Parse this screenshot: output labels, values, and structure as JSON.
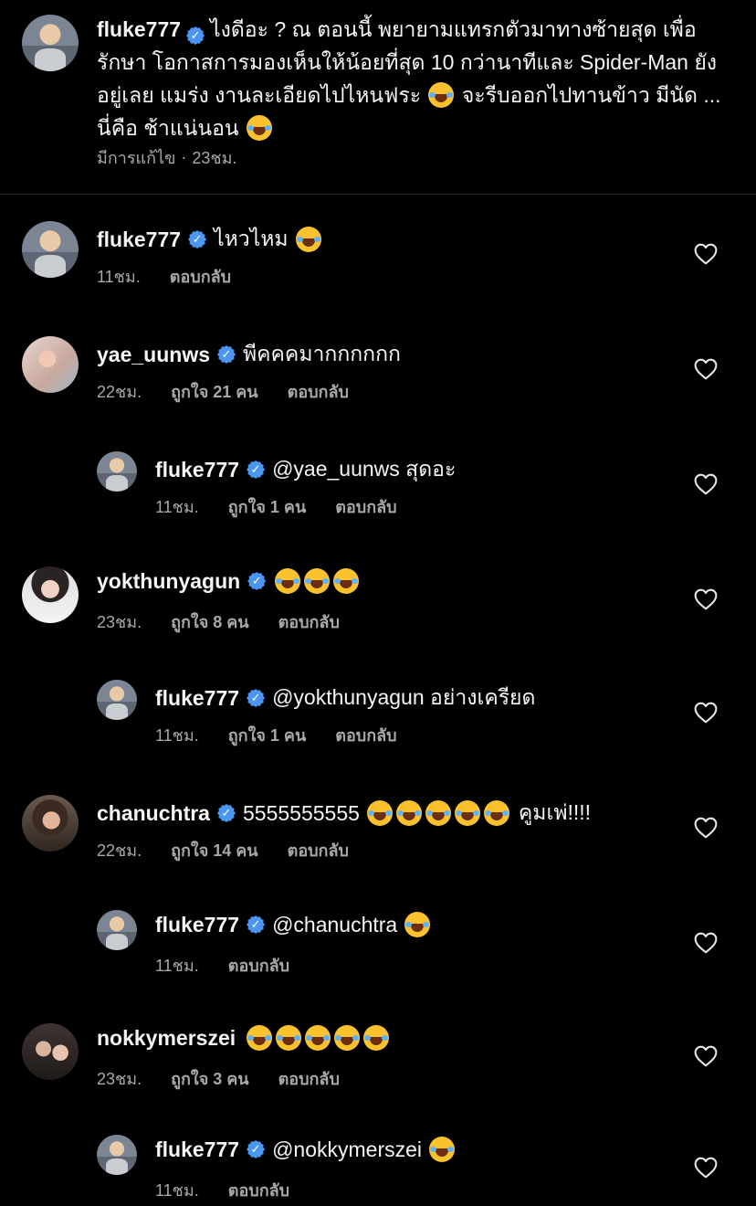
{
  "caption": {
    "username": "fluke777",
    "text_1": "ไงดีอะ ? ณ ตอนนี้ พยายามแทรกตัวมาทางซ้ายสุด เพื่อรักษา โอกาสการมองเห็นให้น้อยที่สุด 10 กว่านาทีและ Spider-Man ยังอยู่เลย แมร่ง งานละเอียดไปไหนฟระ",
    "text_2": "จะรีบออกไปทานข้าว มีนัด ... นี่คือ ช้าแน่นอน",
    "edited_label": "มีการแก้ไข",
    "separator": "·",
    "time": "23ชม."
  },
  "reply_label": "ตอบกลับ",
  "comments": [
    {
      "username": "fluke777",
      "text": "ไหวไหม",
      "emoji_count": 1,
      "time": "11ชม.",
      "likes": ""
    },
    {
      "username": "yae_uunws",
      "text": "พีคคคมากกกกกก",
      "emoji_count": 0,
      "time": "22ชม.",
      "likes": "ถูกใจ 21 คน"
    },
    {
      "username": "fluke777",
      "text": "@yae_uunws สุดอะ",
      "emoji_count": 0,
      "time": "11ชม.",
      "likes": "ถูกใจ 1 คน"
    },
    {
      "username": "yokthunyagun",
      "text": "",
      "emoji_count": 3,
      "time": "23ชม.",
      "likes": "ถูกใจ 8 คน"
    },
    {
      "username": "fluke777",
      "text": "@yokthunyagun อย่างเครียด",
      "emoji_count": 0,
      "time": "11ชม.",
      "likes": "ถูกใจ 1 คน"
    },
    {
      "username": "chanuchtra",
      "text": "5555555555",
      "emoji_count": 5,
      "text_after": "คูมเพ่!!!!",
      "time": "22ชม.",
      "likes": "ถูกใจ 14 คน"
    },
    {
      "username": "fluke777",
      "text": "@chanuchtra",
      "emoji_count": 1,
      "time": "11ชม.",
      "likes": ""
    },
    {
      "username": "nokkymerszei",
      "text": "",
      "emoji_count": 5,
      "time": "23ชม.",
      "likes": "ถูกใจ 3 คน"
    },
    {
      "username": "fluke777",
      "text": "@nokkymerszei",
      "emoji_count": 1,
      "time": "11ชม.",
      "likes": ""
    }
  ],
  "icons": {
    "verified": "verified-badge-icon",
    "like": "heart-icon",
    "emoji": "face-with-tears-of-joy-emoji"
  },
  "colors": {
    "background": "#000000",
    "text": "#f5f5f5",
    "muted": "#a8a8a8",
    "verified": "#4a96f2",
    "divider": "#2a2a2a"
  }
}
